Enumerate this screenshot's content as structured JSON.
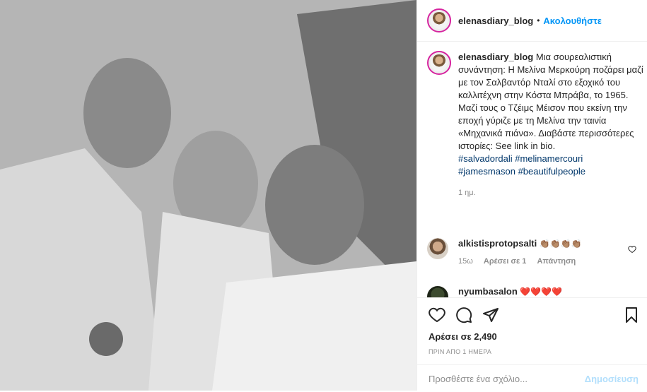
{
  "header": {
    "username": "elenasdiary_blog",
    "separator": "•",
    "follow_label": "Ακολουθήστε"
  },
  "caption": {
    "username": "elenasdiary_blog",
    "text": "Μια σουρεαλιστική συνάντηση: Η Μελίνα Μερκούρη ποζάρει μαζί με τον Σαλβαντόρ Νταλί στο εξοχικό του καλλιτέχνη στην Κόστα Μπράβα, το 1965. Μαζί τους ο Τζέιμς Μέισον που εκείνη την εποχή γύριζε με τη Μελίνα την ταινία «Μηχανικά πιάνα». Διαβάστε περισσότερες ιστορίες: See link in bio.",
    "hashtags": [
      "#salvadordali",
      "#melinamercouri",
      "#jamesmason",
      "#beautifulpeople"
    ],
    "age": "1 ημ."
  },
  "comments": [
    {
      "username": "alkistisprotopsalti",
      "text": "👏🏽👏🏽👏🏽👏🏽",
      "age": "15ω",
      "likes_label": "Αρέσει σε 1",
      "reply_label": "Απάντηση"
    },
    {
      "username": "nyumbasalon",
      "text": "❤️❤️❤️❤️"
    }
  ],
  "actions": {
    "likes": "Αρέσει σε 2,490",
    "date": "ΠΡΙΝ ΑΠΟ 1 ΗΜΕΡΑ",
    "comment_placeholder": "Προσθέστε ένα σχόλιο...",
    "publish_label": "Δημοσίευση",
    "icons": [
      "heart-icon",
      "comment-icon",
      "share-icon",
      "bookmark-icon"
    ]
  },
  "colors": {
    "link_blue": "#0095f6",
    "hashtag": "#00376b",
    "muted": "#8e8e8e",
    "publish_disabled": "#b2dffc"
  }
}
